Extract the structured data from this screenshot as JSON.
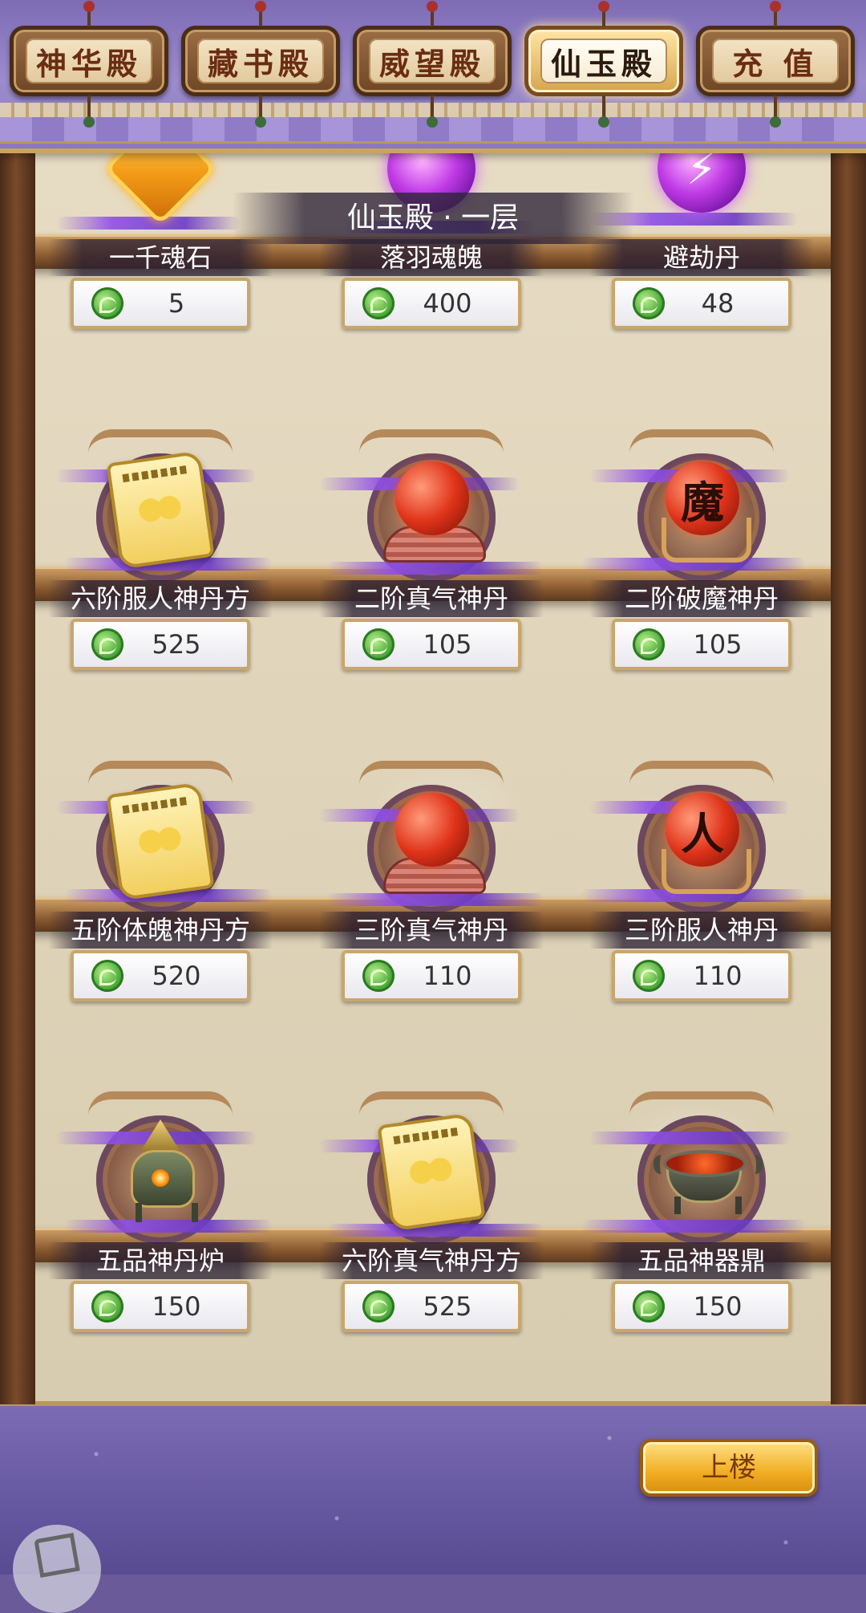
{
  "tabs": [
    {
      "label": "神华殿",
      "active": false
    },
    {
      "label": "藏书殿",
      "active": false
    },
    {
      "label": "威望殿",
      "active": false
    },
    {
      "label": "仙玉殿",
      "active": true
    },
    {
      "label": "充 值",
      "active": false
    }
  ],
  "floor_title": "仙玉殿 · 一层",
  "currency_icon": "jade-dragon-coin-icon",
  "items": [
    {
      "name": "一千魂石",
      "price": "5",
      "icon": "amber-gem-icon"
    },
    {
      "name": "落羽魂魄",
      "price": "400",
      "icon": "purple-soul-orb-icon"
    },
    {
      "name": "避劫丹",
      "price": "48",
      "icon": "lightning-orb-icon"
    },
    {
      "name": "六阶服人神丹方",
      "price": "525",
      "icon": "recipe-scroll-icon"
    },
    {
      "name": "二阶真气神丹",
      "price": "105",
      "icon": "red-pill-orb-icon"
    },
    {
      "name": "二阶破魔神丹",
      "price": "105",
      "icon": "demon-pill-orb-icon",
      "glyph": "魔"
    },
    {
      "name": "五阶体魄神丹方",
      "price": "520",
      "icon": "recipe-scroll-icon"
    },
    {
      "name": "三阶真气神丹",
      "price": "110",
      "icon": "red-pill-orb-icon"
    },
    {
      "name": "三阶服人神丹",
      "price": "110",
      "icon": "person-pill-orb-icon",
      "glyph": "人"
    },
    {
      "name": "五品神丹炉",
      "price": "150",
      "icon": "pill-furnace-icon"
    },
    {
      "name": "六阶真气神丹方",
      "price": "525",
      "icon": "recipe-scroll-icon"
    },
    {
      "name": "五品神器鼎",
      "price": "150",
      "icon": "tripod-cauldron-icon"
    }
  ],
  "upstairs_label": "上楼",
  "colors": {
    "banner": "#8c7bc4",
    "tab_active": "#ffe6a5",
    "button": "#f1ad22",
    "price_text": "#333333"
  }
}
